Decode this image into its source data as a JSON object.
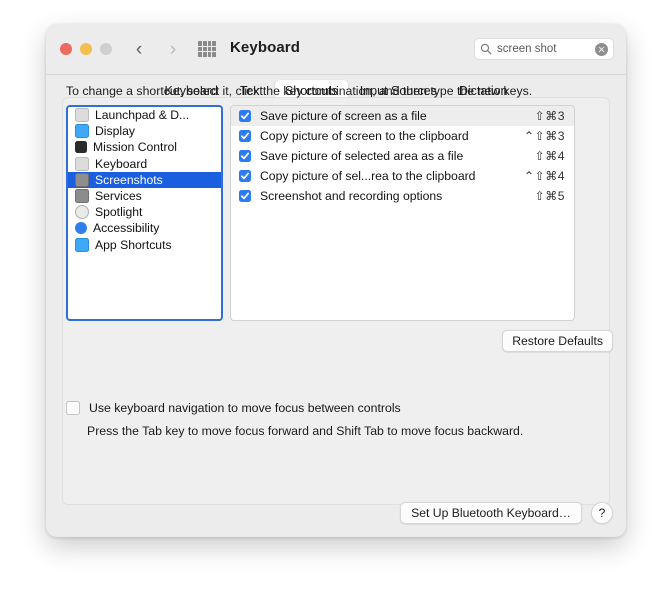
{
  "window": {
    "title": "Keyboard",
    "traffic_lights": [
      "close-red",
      "minimize-yellow",
      "zoom-gray"
    ],
    "nav_back": "‹",
    "nav_forward": "›",
    "grid_icon": "grid-apps-icon"
  },
  "search": {
    "value": "screen shot",
    "placeholder": "Search",
    "icon": "search-icon",
    "clear_icon": "clear-icon"
  },
  "tabs": [
    {
      "label": "Keyboard",
      "active": false
    },
    {
      "label": "Text",
      "active": false
    },
    {
      "label": "Shortcuts",
      "active": true
    },
    {
      "label": "Input Sources",
      "active": false
    },
    {
      "label": "Dictation",
      "active": false
    }
  ],
  "hint": "To change a shortcut, select it, click the key combination, and then type the new keys.",
  "sidebar": {
    "items": [
      {
        "label": "Launchpad & D...",
        "icon": "launchpad-icon",
        "color": "#c9c9c9",
        "selected": false
      },
      {
        "label": "Display",
        "icon": "display-icon",
        "color": "#3fa9f5",
        "selected": false
      },
      {
        "label": "Mission Control",
        "icon": "mission-control-icon",
        "color": "#2b2b2b",
        "selected": false
      },
      {
        "label": "Keyboard",
        "icon": "keyboard-icon",
        "color": "#c9c9c9",
        "selected": false
      },
      {
        "label": "Screenshots",
        "icon": "screenshots-icon",
        "color": "#4a4a4a",
        "selected": true
      },
      {
        "label": "Services",
        "icon": "services-icon",
        "color": "#6e6e6e",
        "selected": false
      },
      {
        "label": "Spotlight",
        "icon": "spotlight-icon",
        "color": "#9a9a9a",
        "selected": false
      },
      {
        "label": "Accessibility",
        "icon": "accessibility-icon",
        "color": "#2f7fe8",
        "selected": false
      },
      {
        "label": "App Shortcuts",
        "icon": "app-shortcuts-icon",
        "color": "#3fa9f5",
        "selected": false
      }
    ]
  },
  "shortcuts": {
    "rows": [
      {
        "checked": true,
        "label": "Save picture of screen as a file",
        "keys": "⇧⌘3",
        "highlighted": true
      },
      {
        "checked": true,
        "label": "Copy picture of screen to the clipboard",
        "keys": "⌃⇧⌘3",
        "highlighted": false
      },
      {
        "checked": true,
        "label": "Save picture of selected area as a file",
        "keys": "⇧⌘4",
        "highlighted": false
      },
      {
        "checked": true,
        "label": "Copy picture of sel...rea to the clipboard",
        "keys": "⌃⇧⌘4",
        "highlighted": false
      },
      {
        "checked": true,
        "label": "Screenshot and recording options",
        "keys": "⇧⌘5",
        "highlighted": false
      }
    ]
  },
  "buttons": {
    "restore_defaults": "Restore Defaults",
    "set_up_bluetooth": "Set Up Bluetooth Keyboard…",
    "help": "?"
  },
  "keyboard_nav": {
    "checked": false,
    "label": "Use keyboard navigation to move focus between controls",
    "note": "Press the Tab key to move focus forward and Shift Tab to move focus backward."
  },
  "colors": {
    "accent": "#2b7bf3",
    "selection": "#1a5fe0",
    "window_bg": "#ececec",
    "panel_bg": "#efefef"
  }
}
